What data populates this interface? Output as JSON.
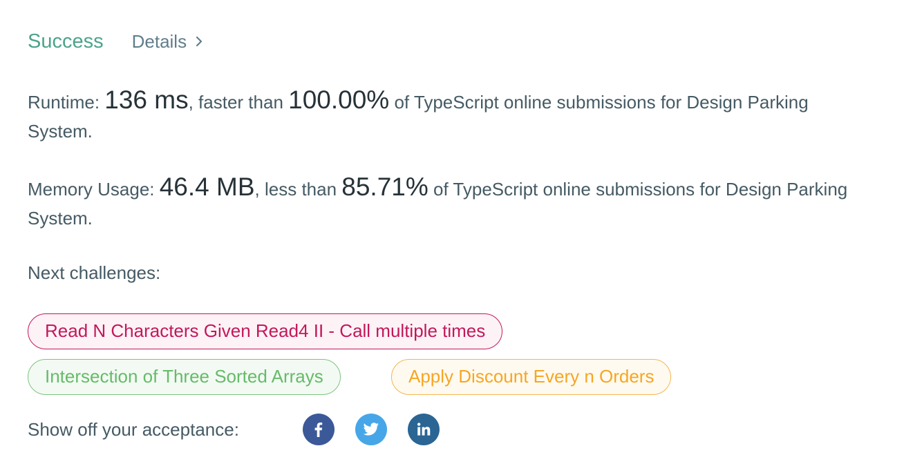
{
  "header": {
    "status": "Success",
    "details_label": "Details",
    "status_color": "#4ca38b"
  },
  "runtime": {
    "label": "Runtime: ",
    "value": "136 ms",
    "comparison": ", faster than ",
    "percent": "100.00%",
    "suffix": " of TypeScript online submissions for Design Parking System."
  },
  "memory": {
    "label": "Memory Usage: ",
    "value": "46.4 MB",
    "comparison": ", less than ",
    "percent": "85.71%",
    "suffix": " of TypeScript online submissions for Design Parking System."
  },
  "next_challenges": {
    "label": "Next challenges:",
    "items": [
      {
        "title": "Read N Characters Given Read4 II - Call multiple times",
        "difficulty_color": "#c2185b"
      },
      {
        "title": "Intersection of Three Sorted Arrays",
        "difficulty_color": "#66bb6a"
      },
      {
        "title": "Apply Discount Every n Orders",
        "difficulty_color": "#f6a623"
      }
    ]
  },
  "share": {
    "label": "Show off your acceptance:",
    "icons": [
      "facebook-icon",
      "twitter-icon",
      "linkedin-icon"
    ],
    "colors": [
      "#3b5998",
      "#47a6e8",
      "#2a6594"
    ]
  }
}
